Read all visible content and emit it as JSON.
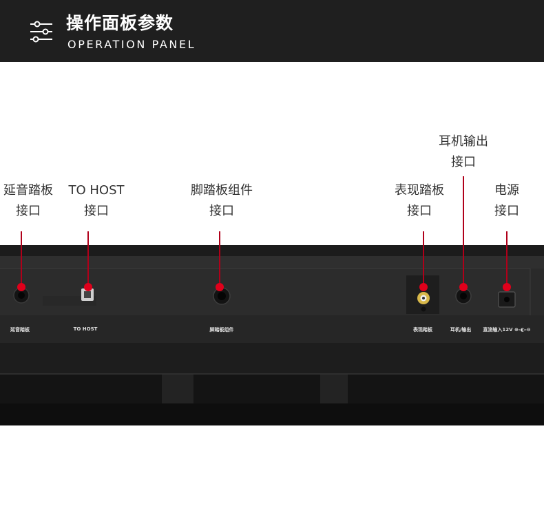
{
  "header": {
    "title": "操作面板参数",
    "subtitle": "OPERATION PANEL",
    "icon": "sliders-icon"
  },
  "callouts": [
    {
      "id": "sustain",
      "line1": "延音踏板",
      "line2": "接口"
    },
    {
      "id": "tohost",
      "line1": "TO HOST",
      "line2": "接口"
    },
    {
      "id": "pedalunit",
      "line1": "脚踏板组件",
      "line2": "接口"
    },
    {
      "id": "expression",
      "line1": "表现踏板",
      "line2": "接口"
    },
    {
      "id": "headphone",
      "line1": "耳机输出",
      "line2": "接口"
    },
    {
      "id": "power",
      "line1": "电源",
      "line2": "接口"
    }
  ],
  "panel_labels": {
    "sustain": "延音踏板",
    "tohost": "TO HOST",
    "pedalunit": "脚踏板组件",
    "expression": "表现踏板",
    "headphone": "耳机/输出",
    "power": "直流输入12V ⊕-◐-⊖"
  },
  "colors": {
    "header_bg": "#1f1f1f",
    "marker": "#e0001b",
    "line": "#b0001a",
    "panel": "#262626"
  }
}
